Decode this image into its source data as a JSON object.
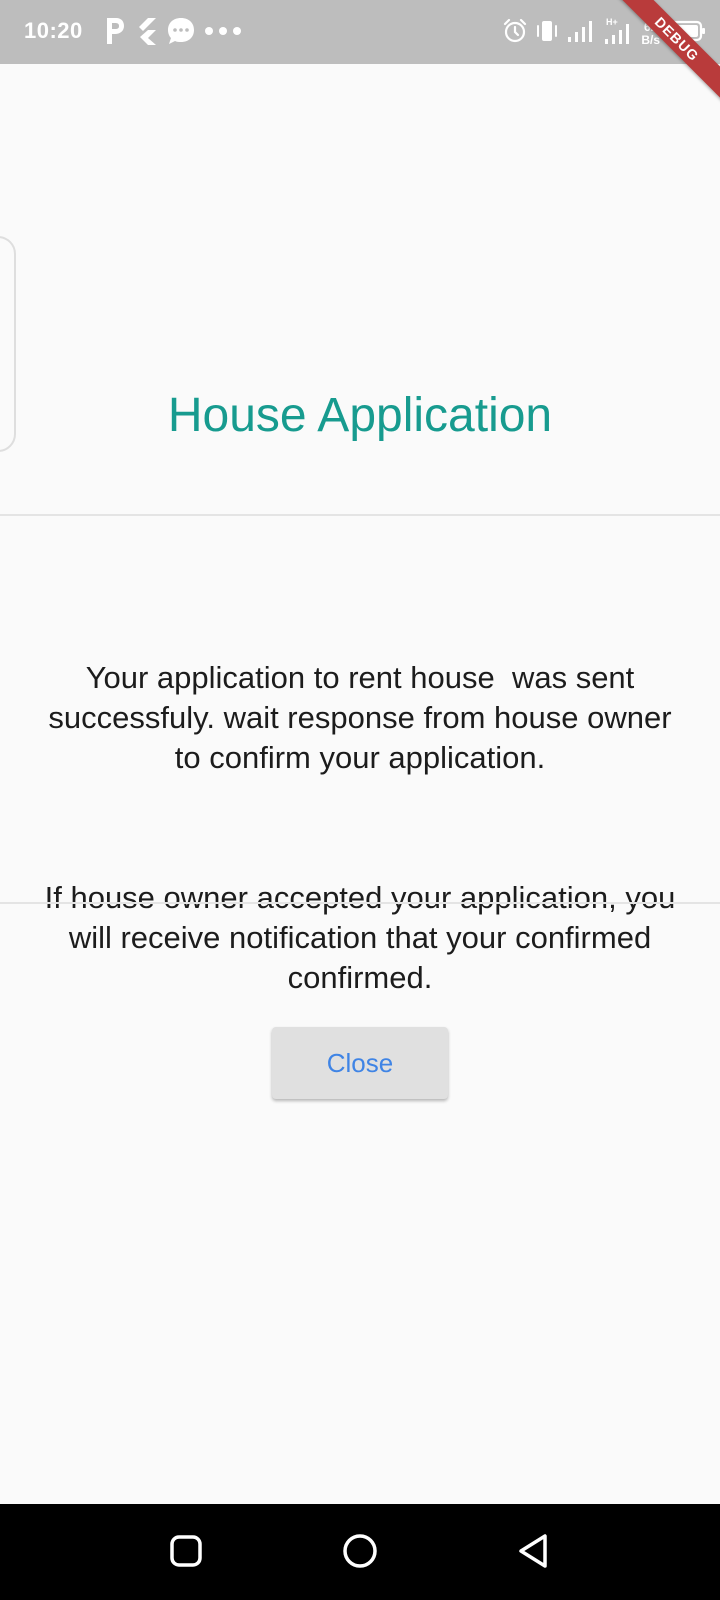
{
  "status_bar": {
    "time": "10:20",
    "net_speed_value": "62",
    "net_speed_unit": "B/s",
    "network_type": "H+",
    "left_icons": [
      "parking-app-icon",
      "flutter-icon",
      "messages-icon",
      "more-dots-icon"
    ],
    "right_icons": [
      "alarm-icon",
      "vibrate-icon",
      "signal-icon",
      "signal-icon",
      "battery-icon"
    ]
  },
  "debug_banner": {
    "label": "DEBUG"
  },
  "dialog": {
    "title": "House Application",
    "message_1": "Your application to rent house  was sent successfuly. wait response from house owner to confirm your application.",
    "message_2": "If house owner accepted your application, you will receive notification that your confirmed confirmed.",
    "close_label": "Close"
  },
  "nav_bar": {
    "buttons": [
      "recents-icon",
      "home-icon",
      "back-icon"
    ]
  },
  "colors": {
    "title": "#179b8f",
    "button_text": "#3f84e5",
    "button_bg": "#e0e0e0",
    "status_bar": "#bdbdbd",
    "debug_ribbon": "#b93b3b"
  }
}
